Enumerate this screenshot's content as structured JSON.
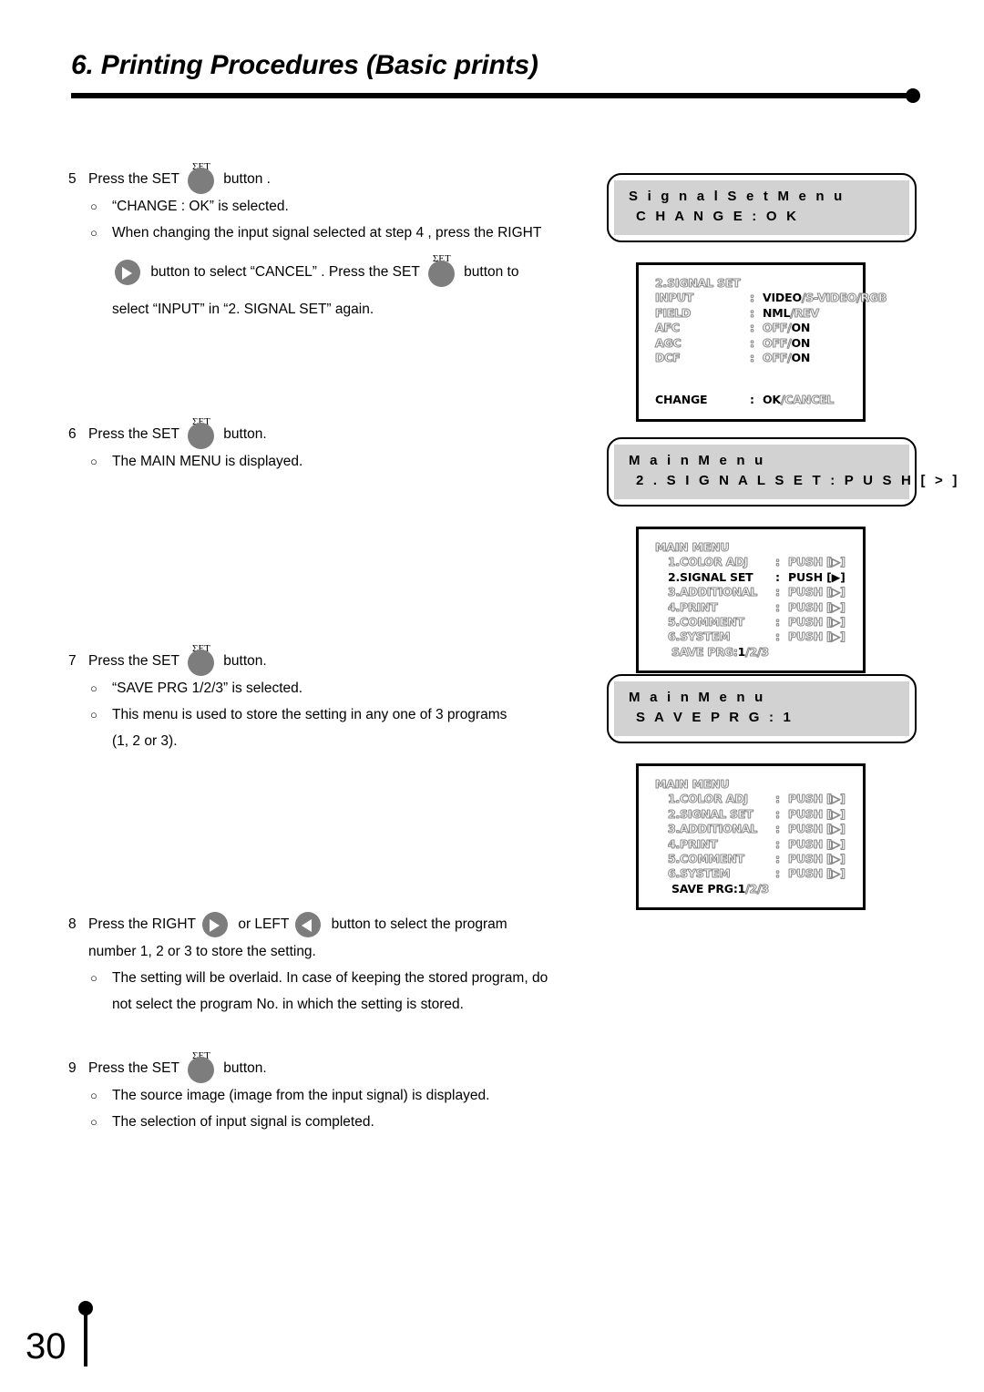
{
  "header": {
    "title": "6. Printing Procedures (Basic prints)"
  },
  "footer": {
    "page_number": "30"
  },
  "buttons": {
    "set_cap": "ΣET",
    "right_icon": "right-triangle-icon",
    "left_icon": "left-triangle-icon"
  },
  "steps": [
    {
      "number": "5",
      "pre": "Press the SET",
      "post": "button .",
      "bullets": [
        "“CHANGE   : OK” is selected.",
        "When changing the input signal selected at step 4 , press the RIGHT"
      ],
      "cont_pre": "button  to select “CANCEL” .  Press the SET",
      "cont_post": "button  to",
      "cont_last": "select “INPUT” in “2. SIGNAL  SET” again."
    },
    {
      "number": "6",
      "pre": "Press the SET",
      "post": "button.",
      "bullets": [
        "The MAIN MENU is displayed."
      ]
    },
    {
      "number": "7",
      "pre": "Press the SET",
      "post": "button.",
      "bullets": [
        "“SAVE  PRG  1/2/3” is selected.",
        "This menu is used to store the setting in any one of 3 programs"
      ],
      "cont_last": "(1, 2 or 3)."
    },
    {
      "number": "8",
      "pre": "Press the RIGHT",
      "mid": "or LEFT",
      "post": "button to select the program",
      "line2": "number 1, 2 or 3 to store the setting.",
      "bullets": [
        "The setting will be overlaid.  In case of keeping the stored program, do"
      ],
      "cont_last": "not select the program No. in which the setting is stored."
    },
    {
      "number": "9",
      "pre": "Press the SET",
      "post": "button.",
      "bullets": [
        "The source image (image from the input signal) is displayed.",
        "The selection of input signal is completed."
      ]
    }
  ],
  "osd_groups": [
    {
      "banner": {
        "line1": "S i g n a l  S e t  M e n u",
        "line2": "C H A N G E : O K"
      },
      "screen": {
        "title": "2.SIGNAL  SET",
        "rows": [
          {
            "label": "INPUT",
            "colon": ":",
            "values": [
              {
                "text": "VIDEO",
                "state": "solid"
              },
              {
                "text": "/",
                "state": "hollow"
              },
              {
                "text": "S-VIDEO",
                "state": "hollow"
              },
              {
                "text": "/",
                "state": "hollow"
              },
              {
                "text": "RGB",
                "state": "hollow"
              }
            ]
          },
          {
            "label": "FIELD",
            "colon": ":",
            "values": [
              {
                "text": "NML",
                "state": "solid"
              },
              {
                "text": "/",
                "state": "hollow"
              },
              {
                "text": "REV",
                "state": "hollow"
              }
            ]
          },
          {
            "label": "AFC",
            "colon": ":",
            "values": [
              {
                "text": "OFF",
                "state": "hollow"
              },
              {
                "text": "/",
                "state": "hollow"
              },
              {
                "text": "ON",
                "state": "solid"
              }
            ]
          },
          {
            "label": "AGC",
            "colon": ":",
            "values": [
              {
                "text": "OFF",
                "state": "hollow"
              },
              {
                "text": "/",
                "state": "hollow"
              },
              {
                "text": "ON",
                "state": "solid"
              }
            ]
          },
          {
            "label": "DCF",
            "colon": ":",
            "values": [
              {
                "text": "OFF",
                "state": "hollow"
              },
              {
                "text": "/",
                "state": "hollow"
              },
              {
                "text": "ON",
                "state": "solid"
              }
            ]
          }
        ],
        "footer_row": {
          "label": "CHANGE",
          "label_state": "solid",
          "colon": ":",
          "values": [
            {
              "text": "OK",
              "state": "solid"
            },
            {
              "text": "/",
              "state": "hollow"
            },
            {
              "text": "CANCEL",
              "state": "hollow"
            }
          ]
        }
      }
    },
    {
      "banner": {
        "line1": "M a i n  M e n u",
        "line2": "2 . S I G N A L  S E T : P U S H [ > ]"
      },
      "screen": {
        "title": "MAIN MENU",
        "menu_rows": [
          {
            "label": "1.COLOR ADJ",
            "colon": ":",
            "action": "PUSH",
            "bracket_open": "[",
            "arrow": "hollow",
            "bracket_close": "]",
            "state": "hollow"
          },
          {
            "label": "2.SIGNAL  SET",
            "colon": ":",
            "action": "PUSH",
            "bracket_open": "[",
            "arrow": "solid",
            "bracket_close": "]",
            "state": "solid"
          },
          {
            "label": "3.ADDITIONAL",
            "colon": ":",
            "action": "PUSH",
            "bracket_open": "[",
            "arrow": "hollow",
            "bracket_close": "]",
            "state": "hollow"
          },
          {
            "label": "4.PRINT",
            "colon": ":",
            "action": "PUSH",
            "bracket_open": "[",
            "arrow": "hollow",
            "bracket_close": "]",
            "state": "hollow"
          },
          {
            "label": "5.COMMENT",
            "colon": ":",
            "action": "PUSH",
            "bracket_open": "[",
            "arrow": "hollow",
            "bracket_close": "]",
            "state": "hollow"
          },
          {
            "label": "6.SYSTEM",
            "colon": ":",
            "action": "PUSH",
            "bracket_open": "[",
            "arrow": "hollow",
            "bracket_close": "]",
            "state": "hollow"
          }
        ],
        "save_row": {
          "label": "SAVE PRG",
          "label_state": "hollow",
          "colon": ":",
          "values": [
            {
              "text": "1",
              "state": "solid"
            },
            {
              "text": "∕",
              "state": "hollow"
            },
            {
              "text": "2",
              "state": "hollow"
            },
            {
              "text": "∕",
              "state": "hollow"
            },
            {
              "text": "3",
              "state": "hollow"
            }
          ]
        }
      }
    },
    {
      "banner": {
        "line1": "M a i n  M e n u",
        "line2": "S A V E  P R G : 1"
      },
      "screen": {
        "title": "MAIN MENU",
        "menu_rows": [
          {
            "label": "1.COLOR ADJ",
            "colon": ":",
            "action": "PUSH",
            "bracket_open": "[",
            "arrow": "hollow",
            "bracket_close": "]",
            "state": "hollow"
          },
          {
            "label": "2.SIGNAL  SET",
            "colon": ":",
            "action": "PUSH",
            "bracket_open": "[",
            "arrow": "hollow",
            "bracket_close": "]",
            "state": "hollow"
          },
          {
            "label": "3.ADDITIONAL",
            "colon": ":",
            "action": "PUSH",
            "bracket_open": "[",
            "arrow": "hollow",
            "bracket_close": "]",
            "state": "hollow"
          },
          {
            "label": "4.PRINT",
            "colon": ":",
            "action": "PUSH",
            "bracket_open": "[",
            "arrow": "hollow",
            "bracket_close": "]",
            "state": "hollow"
          },
          {
            "label": "5.COMMENT",
            "colon": ":",
            "action": "PUSH",
            "bracket_open": "[",
            "arrow": "hollow",
            "bracket_close": "]",
            "state": "hollow"
          },
          {
            "label": "6.SYSTEM",
            "colon": ":",
            "action": "PUSH",
            "bracket_open": "[",
            "arrow": "hollow",
            "bracket_close": "]",
            "state": "hollow"
          }
        ],
        "save_row": {
          "label": "SAVE PRG",
          "label_state": "solid",
          "colon": ":",
          "values": [
            {
              "text": "1",
              "state": "solid"
            },
            {
              "text": "∕",
              "state": "hollow"
            },
            {
              "text": "2",
              "state": "hollow"
            },
            {
              "text": "∕",
              "state": "hollow"
            },
            {
              "text": "3",
              "state": "hollow"
            }
          ]
        }
      }
    }
  ],
  "colors": {
    "banner_fill": "#d2d2d2",
    "knob": "#7d7d7d",
    "osd_hollow_stroke": "#8a8a8a",
    "ink": "#000000"
  }
}
